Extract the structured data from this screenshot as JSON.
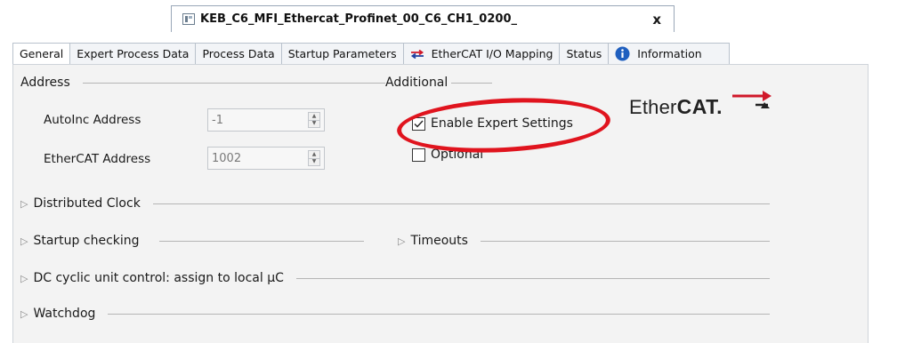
{
  "document_tab": {
    "title": "KEB_C6_MFI_Ethercat_Profinet_00_C6_CH1_0200_",
    "close_label": "x"
  },
  "tabs": [
    {
      "label": "General",
      "active": true
    },
    {
      "label": "Expert Process Data",
      "active": false
    },
    {
      "label": "Process Data",
      "active": false
    },
    {
      "label": "Startup Parameters",
      "active": false
    },
    {
      "label": "EtherCAT I/O Mapping",
      "active": false,
      "icon": "mapping-arrows-icon"
    },
    {
      "label": "Status",
      "active": false
    },
    {
      "label": "Information",
      "active": false,
      "icon": "info-icon"
    }
  ],
  "address": {
    "header": "Address",
    "autoinc_label": "AutoInc Address",
    "autoinc_value": "-1",
    "ethercat_label": "EtherCAT Address",
    "ethercat_value": "1002"
  },
  "additional": {
    "header": "Additional",
    "enable_expert_label": "Enable Expert Settings",
    "enable_expert_checked": true,
    "optional_label": "Optional",
    "optional_checked": false
  },
  "logo": {
    "text_regular": "Ether",
    "text_bold": "CAT."
  },
  "collapsible_sections": {
    "distributed_clock": "Distributed Clock",
    "startup_checking": "Startup checking",
    "timeouts": "Timeouts",
    "dc_cyclic": "DC cyclic unit control: assign to local µC",
    "watchdog": "Watchdog"
  },
  "colors": {
    "highlight_ellipse": "#e0141e",
    "panel_background": "#f3f3f3",
    "mapping_icon": "#d0182a",
    "info_icon": "#1f5fbf"
  }
}
